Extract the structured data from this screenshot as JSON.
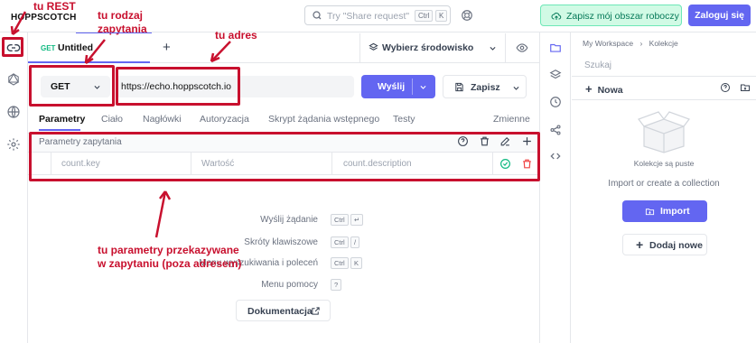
{
  "header": {
    "logo": "HOPPSCOTCH",
    "search_placeholder": "Try \"Share request\"",
    "search_kbd": [
      "Ctrl",
      "K"
    ],
    "save_workspace": "Zapisz mój obszar roboczy",
    "login": "Zaloguj się"
  },
  "tab": {
    "method": "GET",
    "title": "Untitled",
    "add": "+"
  },
  "environment": {
    "label": "Wybierz środowisko"
  },
  "request": {
    "method": "GET",
    "url": "https://echo.hoppscotch.io",
    "send": "Wyślij",
    "save": "Zapisz"
  },
  "subtabs": [
    "Parametry",
    "Ciało",
    "Nagłówki",
    "Autoryzacja",
    "Skrypt żądania wstępnego",
    "Testy"
  ],
  "variables_label": "Zmienne",
  "params": {
    "title": "Parametry zapytania",
    "key_placeholder": "count.key",
    "value_placeholder": "Wartość",
    "description_placeholder": "count.description"
  },
  "shortcuts": [
    {
      "label": "Wyślij żądanie",
      "keys": [
        "Ctrl",
        "↵"
      ]
    },
    {
      "label": "Skróty klawiszowe",
      "keys": [
        "Ctrl",
        "/"
      ]
    },
    {
      "label": "Menu wyszukiwania i poleceń",
      "keys": [
        "Ctrl",
        "K"
      ]
    },
    {
      "label": "Menu pomocy",
      "keys": [
        "?"
      ]
    }
  ],
  "documentation": "Dokumentacja",
  "collections": {
    "breadcrumb_root": "My Workspace",
    "breadcrumb_current": "Kolekcje",
    "search_placeholder": "Szukaj",
    "new": "Nowa",
    "empty": "Kolekcje są puste",
    "import_hint": "Import or create a collection",
    "import_button": "Import",
    "add_new": "Dodaj nowe"
  },
  "annotations": {
    "rest": "tu REST",
    "method": "tu rodzaj zapytania",
    "url": "tu adres",
    "params": "tu parametry przekazywane w zapytaniu (poza adresem)"
  },
  "colors": {
    "accent": "#6366f1",
    "annotation": "#c8102e",
    "success": "#10b981",
    "danger": "#ef4444"
  }
}
